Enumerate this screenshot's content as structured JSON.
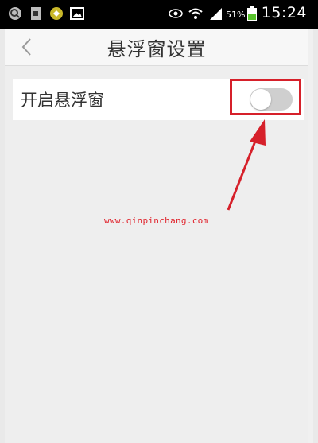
{
  "status_bar": {
    "time": "15:24",
    "battery_percent": "51%",
    "icons": [
      "search-icon",
      "sim-icon",
      "app-icon",
      "image-icon",
      "eye-icon",
      "wifi-icon",
      "signal-icon",
      "battery-icon"
    ]
  },
  "header": {
    "title": "悬浮窗设置",
    "back_icon": "chevron-left-icon"
  },
  "settings": {
    "floating_window": {
      "label": "开启悬浮窗",
      "enabled": false
    }
  },
  "annotation": {
    "watermark": "www.qinpinchang.com",
    "color": "#d6202a"
  },
  "colors": {
    "background": "#eeeeee",
    "toggle_off": "#cfcfcf",
    "highlight": "#d6202a"
  }
}
